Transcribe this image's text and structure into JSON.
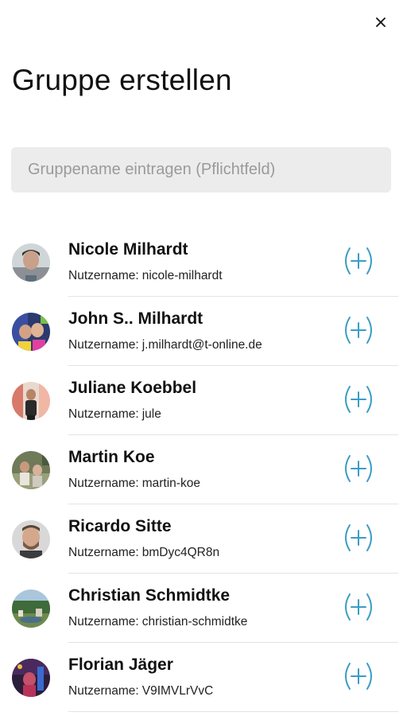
{
  "header": {
    "close_icon": "close-icon",
    "title": "Gruppe erstellen"
  },
  "group_name_field": {
    "value": "",
    "placeholder": "Gruppename eintragen (Pflichtfeld)"
  },
  "colors": {
    "accent": "#3a9dc4",
    "input_background": "#ececec",
    "divider": "#e3e3e3"
  },
  "username_prefix": "Nutzername:",
  "users": [
    {
      "name": "Nicole Milhardt",
      "username": "nicole-milhardt",
      "avatar": "photo-avatar",
      "add_icon": "add-circle-icon"
    },
    {
      "name": "John S.. Milhardt",
      "username": "j.milhardt@t-online.de",
      "avatar": "photo-avatar",
      "add_icon": "add-circle-icon"
    },
    {
      "name": "Juliane Koebbel",
      "username": "jule",
      "avatar": "photo-avatar",
      "add_icon": "add-circle-icon"
    },
    {
      "name": "Martin Koe",
      "username": "martin-koe",
      "avatar": "photo-avatar",
      "add_icon": "add-circle-icon"
    },
    {
      "name": "Ricardo Sitte",
      "username": "bmDyc4QR8n",
      "avatar": "photo-avatar",
      "add_icon": "add-circle-icon"
    },
    {
      "name": "Christian Schmidtke",
      "username": "christian-schmidtke",
      "avatar": "photo-avatar",
      "add_icon": "add-circle-icon"
    },
    {
      "name": "Florian Jäger",
      "username": "V9IMVLrVvC",
      "avatar": "photo-avatar",
      "add_icon": "add-circle-icon"
    }
  ]
}
